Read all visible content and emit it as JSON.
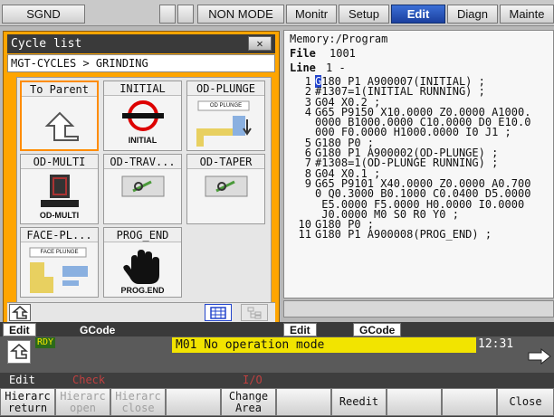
{
  "top_tabs": [
    {
      "label": "SGND"
    },
    {
      "label": ""
    },
    {
      "label": ""
    },
    {
      "label": "NON MODE"
    },
    {
      "label": "Monitr"
    },
    {
      "label": "Setup"
    },
    {
      "label": "Edit"
    },
    {
      "label": "Diagn"
    },
    {
      "label": "Mainte"
    }
  ],
  "cycle_window": {
    "title": "Cycle list",
    "close_glyph": "✕",
    "path": "MGT-CYCLES > GRINDING",
    "cells": [
      {
        "label": "To Parent",
        "icon": "up-arrow-icon"
      },
      {
        "label": "INITIAL",
        "icon": "initial-icon",
        "caption": "INITIAL"
      },
      {
        "label": "OD-PLUNGE",
        "icon": "od-plunge-icon",
        "caption": "OD PLUNGE"
      },
      {
        "label": "OD-MULTI",
        "icon": "od-multi-icon",
        "caption": "OD-MULTI"
      },
      {
        "label": "OD-TRAV...",
        "icon": "od-trav-icon"
      },
      {
        "label": "OD-TAPER",
        "icon": "od-taper-icon"
      },
      {
        "label": "FACE-PL...",
        "icon": "face-plunge-icon",
        "caption": "FACE PLUNGE"
      },
      {
        "label": "PROG_END",
        "icon": "hand-stop-icon",
        "caption": "PROG.END"
      }
    ]
  },
  "program": {
    "memory": "Memory:/Program",
    "file_label": "File",
    "file_value": "1001",
    "line_label": "Line",
    "line_value": "1 -",
    "lines": [
      {
        "n": "1",
        "cursor": "G",
        "t": "180 P1 A900007(INITIAL) ;"
      },
      {
        "n": "2",
        "t": "#1307=1(INITIAL RUNNING) ;"
      },
      {
        "n": "3",
        "t": "G04 X0.2 ;"
      },
      {
        "n": "4",
        "t": "G65 P9150 X10.0000 Z0.0000 A1000."
      },
      {
        "n": "",
        "t": "0000 B1000.0000 C10.0000 D0 E10.0"
      },
      {
        "n": "",
        "t": "000 F0.0000 H1000.0000 I0 J1 ;"
      },
      {
        "n": "5",
        "t": "G180 P0 ;"
      },
      {
        "n": "6",
        "t": "G180 P1 A900002(OD-PLUNGE) ;"
      },
      {
        "n": "7",
        "t": "#1308=1(OD-PLUNGE RUNNING) ;"
      },
      {
        "n": "8",
        "t": "G04 X0.1 ;"
      },
      {
        "n": "9",
        "t": "G65 P9101 X40.0000 Z0.0000 A0.700"
      },
      {
        "n": "",
        "t": "0 Q0.3000 B0.1000 C0.0400 D5.0000"
      },
      {
        "n": "",
        "t": " E5.0000 F5.0000 H0.0000 I0.0000"
      },
      {
        "n": "",
        "t": " J0.0000 M0 S0 R0 Y0 ;"
      },
      {
        "n": "10",
        "t": "G180 P0 ;"
      },
      {
        "n": "11",
        "t": "G180 P1 A900008(PROG_END) ;"
      }
    ]
  },
  "edit_tabs_left": {
    "active": "Edit",
    "inactive": "GCode"
  },
  "edit_tabs_right": {
    "active": "Edit",
    "inactive": "GCode"
  },
  "status": {
    "rdy": "RDY",
    "message": "M01  No operation mode",
    "clock": "12:31"
  },
  "fkey_labels": {
    "edit": "Edit",
    "check": "Check",
    "io": "I/O"
  },
  "fkeys": [
    {
      "l1": "Hierarc",
      "l2": "return",
      "enabled": true
    },
    {
      "l1": "Hierarc",
      "l2": "open",
      "enabled": false
    },
    {
      "l1": "Hierarc",
      "l2": "close",
      "enabled": false
    },
    {
      "l1": "",
      "l2": "",
      "enabled": true
    },
    {
      "l1": "Change",
      "l2": "Area",
      "enabled": true
    },
    {
      "l1": "",
      "l2": "",
      "enabled": true
    },
    {
      "l1": "Reedit",
      "l2": "",
      "enabled": true
    },
    {
      "l1": "",
      "l2": "",
      "enabled": true
    },
    {
      "l1": "",
      "l2": "",
      "enabled": true
    },
    {
      "l1": "Close",
      "l2": "",
      "enabled": true
    }
  ],
  "colors": {
    "accent": "#ffa500",
    "active_tab": "#1b3f9e",
    "message_bg": "#f2e400"
  }
}
